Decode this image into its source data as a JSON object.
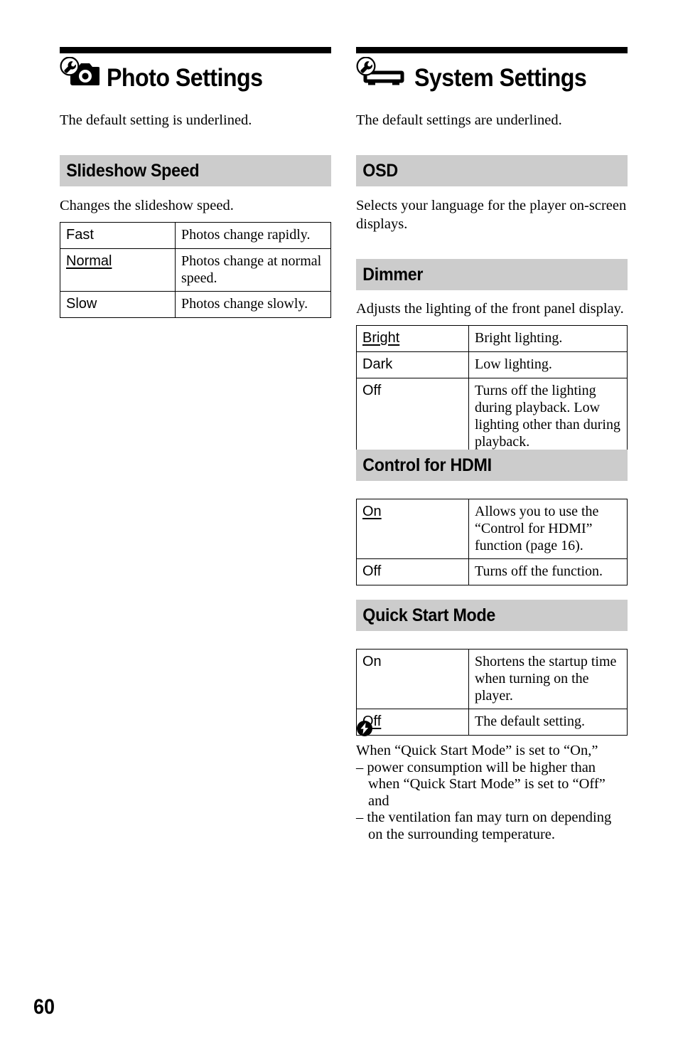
{
  "page": {
    "number": "60"
  },
  "left_column": {
    "chapter": {
      "icon": "wrench-camera-icon",
      "title": "Photo Settings",
      "intro": "The default setting is underlined."
    },
    "sections": [
      {
        "heading": "Slideshow Speed",
        "description": "Changes the slideshow speed.",
        "rows": [
          {
            "term": "Fast",
            "underlined": false,
            "desc": "Photos change rapidly."
          },
          {
            "term": "Normal",
            "underlined": true,
            "desc": "Photos change at normal speed."
          },
          {
            "term": "Slow",
            "underlined": false,
            "desc": "Photos change slowly."
          }
        ]
      }
    ]
  },
  "right_column": {
    "chapter": {
      "icon": "wrench-player-icon",
      "title": "System Settings",
      "intro": "The default settings are underlined."
    },
    "sections": [
      {
        "heading": "OSD",
        "description": "Selects your language for the player on-screen displays.",
        "rows": []
      },
      {
        "heading": "Dimmer",
        "description": "Adjusts the lighting of the front panel display.",
        "rows": [
          {
            "term": "Bright",
            "underlined": true,
            "desc": "Bright lighting."
          },
          {
            "term": "Dark",
            "underlined": false,
            "desc": "Low lighting."
          },
          {
            "term": "Off",
            "underlined": false,
            "desc": "Turns off the lighting during playback. Low lighting other than during playback."
          }
        ]
      },
      {
        "heading": "Control for HDMI",
        "description": "",
        "rows": [
          {
            "term": "On",
            "underlined": true,
            "desc": "Allows you to use the “Control for HDMI” function (page 16)."
          },
          {
            "term": "Off",
            "underlined": false,
            "desc": "Turns off the function."
          }
        ]
      },
      {
        "heading": "Quick Start Mode",
        "description": "",
        "rows": [
          {
            "term": "On",
            "underlined": false,
            "desc": "Shortens the startup time when turning on the player."
          },
          {
            "term": "Off",
            "underlined": true,
            "desc": "The default setting."
          }
        ]
      }
    ],
    "note": {
      "icon": "note-bolt-icon",
      "lead": "When “Quick Start Mode” is set to “On,”",
      "items": [
        "– power consumption will be higher than when “Quick Start Mode” is set to “Off” and",
        "– the ventilation fan may turn on depending on the surrounding temperature."
      ]
    }
  },
  "colors": {
    "band": "#cccccc",
    "rule": "#000000",
    "text": "#000000"
  }
}
